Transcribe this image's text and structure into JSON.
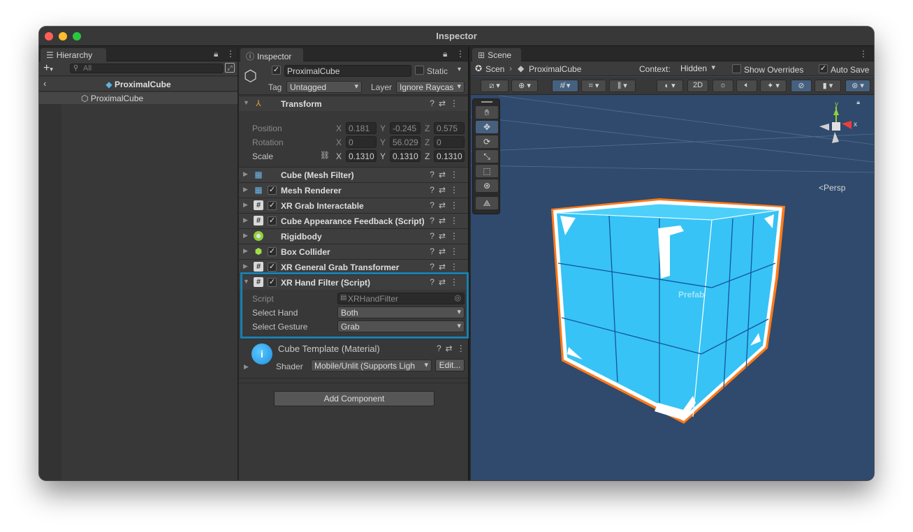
{
  "window": {
    "title": "Inspector"
  },
  "hierarchy": {
    "tab_label": "Hierarchy",
    "search_placeholder": "All",
    "header_title": "ProximalCube",
    "items": [
      {
        "label": "ProximalCube"
      }
    ]
  },
  "inspector": {
    "tab_label": "Inspector",
    "object_name": "ProximalCube",
    "static_label": "Static",
    "tag_label": "Tag",
    "tag_value": "Untagged",
    "layer_label": "Layer",
    "layer_value": "Ignore Raycas",
    "transform": {
      "name": "Transform",
      "position": {
        "label": "Position",
        "x": "0.181",
        "y": "-0.245",
        "z": "0.575"
      },
      "rotation": {
        "label": "Rotation",
        "x": "0",
        "y": "56.029",
        "z": "0"
      },
      "scale": {
        "label": "Scale",
        "x": "0.1310",
        "y": "0.1310",
        "z": "0.1310"
      },
      "axis_x": "X",
      "axis_y": "Y",
      "axis_z": "Z"
    },
    "components": [
      {
        "name": "Cube (Mesh Filter)",
        "icon": "grid-icon",
        "checkbox": false
      },
      {
        "name": "Mesh Renderer",
        "icon": "grid-icon",
        "checkbox": true
      },
      {
        "name": "XR Grab Interactable",
        "icon": "script-icon",
        "checkbox": true
      },
      {
        "name": "Cube Appearance Feedback (Script)",
        "icon": "script-icon",
        "checkbox": true
      },
      {
        "name": "Rigidbody",
        "icon": "rigidbody-icon",
        "checkbox": false
      },
      {
        "name": "Box Collider",
        "icon": "box-collider-icon",
        "checkbox": true
      },
      {
        "name": "XR General Grab Transformer",
        "icon": "script-icon",
        "checkbox": true
      },
      {
        "name": "XR Hand Filter (Script)",
        "icon": "script-icon",
        "checkbox": true
      }
    ],
    "hand_filter": {
      "script_label": "Script",
      "script_value": "XRHandFilter",
      "select_hand_label": "Select Hand",
      "select_hand_value": "Both",
      "select_gesture_label": "Select Gesture",
      "select_gesture_value": "Grab"
    },
    "material": {
      "name": "Cube Template (Material)",
      "shader_label": "Shader",
      "shader_value": "Mobile/Unlit (Supports Ligh",
      "edit_label": "Edit..."
    },
    "add_component_label": "Add Component"
  },
  "scene": {
    "tab_label": "Scene",
    "breadcrumb_root": "Scen",
    "breadcrumb_object": "ProximalCube",
    "context_label": "Context:",
    "context_value": "Hidden",
    "show_overrides_label": "Show Overrides",
    "auto_save_label": "Auto Save",
    "two_d_label": "2D",
    "persp_label": "Persp",
    "prefab_label": "Prefab",
    "gizmo_x": "x",
    "gizmo_y": "y"
  },
  "colors": {
    "accent_highlight": "#1b7fb0",
    "cube_face": "#37c3f5",
    "cube_outline": "#ff7a1a",
    "scene_bg": "#2f4a6d"
  }
}
